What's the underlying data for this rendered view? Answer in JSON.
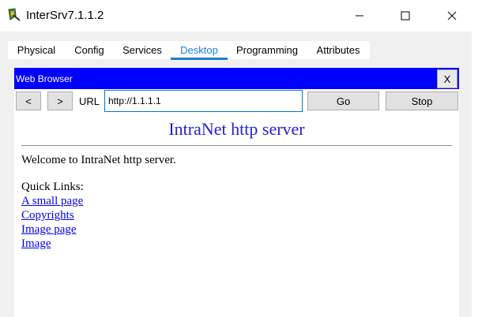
{
  "window": {
    "title": "InterSrv7.1.1.2",
    "icon": "packet-tracer-server-icon",
    "controls": [
      "minimize-icon",
      "maximize-icon",
      "close-icon"
    ]
  },
  "tabs": [
    {
      "label": "Physical",
      "active": false
    },
    {
      "label": "Config",
      "active": false
    },
    {
      "label": "Services",
      "active": false
    },
    {
      "label": "Desktop",
      "active": true
    },
    {
      "label": "Programming",
      "active": false
    },
    {
      "label": "Attributes",
      "active": false
    }
  ],
  "browser": {
    "title": "Web Browser",
    "close_label": "X",
    "back_label": "<",
    "forward_label": ">",
    "url_label": "URL",
    "url_value": "http://1.1.1.1",
    "go_label": "Go",
    "stop_label": "Stop",
    "accent_color": "#0000ff"
  },
  "page": {
    "heading": "IntraNet http server",
    "welcome": "Welcome to IntraNet http server.",
    "quick_links_title": "Quick Links:",
    "links": [
      "A small page",
      "Copyrights",
      "Image page",
      "Image"
    ],
    "heading_color": "#2020d0",
    "link_color": "#0000ee"
  }
}
